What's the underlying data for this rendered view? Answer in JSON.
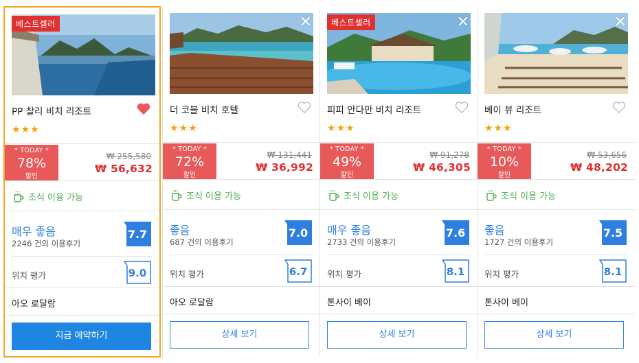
{
  "cards": [
    {
      "badge": "베스트셀러",
      "name": "PP 찰리 비치 리조트",
      "favorited": true,
      "stars": "★★★",
      "today_label": "* TODAY *",
      "discount": "78%",
      "discount_suffix": "할인",
      "original_price": "₩ 255,580",
      "price": "₩ 56,632",
      "breakfast": "조식 이용 가능",
      "rating_label": "매우 좋음",
      "review_count": "2246 건의 이용후기",
      "score": "7.7",
      "location_label": "위치 평가",
      "location_score": "9.0",
      "area": "아오 로달람",
      "button": "지금 예약하기"
    },
    {
      "badge": "",
      "close": "✕",
      "name": "더 코블 비치 호텔",
      "favorited": false,
      "stars": "★★★",
      "today_label": "* TODAY *",
      "discount": "72%",
      "discount_suffix": "할인",
      "original_price": "₩ 131,441",
      "price": "₩ 36,992",
      "breakfast": "조식 이용 가능",
      "rating_label": "좋음",
      "review_count": "687 건의 이용후기",
      "score": "7.0",
      "location_label": "위치 평가",
      "location_score": "6.7",
      "area": "아오 로달람",
      "button": "상세 보기"
    },
    {
      "badge": "베스트셀러",
      "close": "✕",
      "name": "피피 안다만 비치 리조트",
      "favorited": false,
      "stars": "★★★",
      "today_label": "* TODAY *",
      "discount": "49%",
      "discount_suffix": "할인",
      "original_price": "₩ 91,278",
      "price": "₩ 46,305",
      "breakfast": "조식 이용 가능",
      "rating_label": "매우 좋음",
      "review_count": "2733 건의 이용후기",
      "score": "7.6",
      "location_label": "위치 평가",
      "location_score": "8.1",
      "area": "톤사이 베이",
      "button": "상세 보기"
    },
    {
      "badge": "",
      "close": "✕",
      "name": "베이 뷰 리조트",
      "favorited": false,
      "stars": "★★★",
      "today_label": "* TODAY *",
      "discount": "10%",
      "discount_suffix": "할인",
      "original_price": "₩ 53,656",
      "price": "₩ 48,202",
      "breakfast": "조식 이용 가능",
      "rating_label": "좋음",
      "review_count": "1727 건의 이용후기",
      "score": "7.5",
      "location_label": "위치 평가",
      "location_score": "8.1",
      "area": "톤사이 베이",
      "button": "상세 보기"
    }
  ],
  "colors": {
    "accent_blue": "#2f7fe0",
    "sale_red": "#e85a5a",
    "price_red": "#e03131",
    "selected_border": "#f5a623",
    "breakfast_green": "#4caf50",
    "star": "#f5a20a"
  },
  "icons": [
    "heart-icon",
    "close-icon",
    "coffee-cup-icon",
    "star-icon"
  ]
}
